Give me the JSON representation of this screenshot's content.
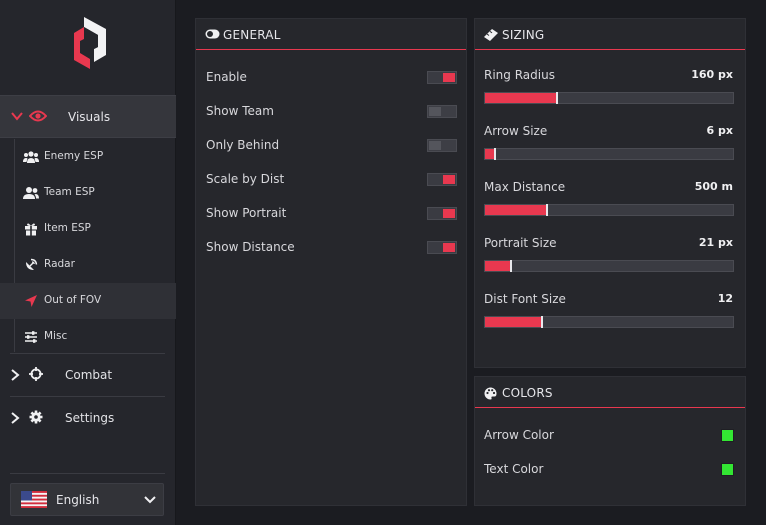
{
  "colors": {
    "accent": "#e8384f",
    "swatch_green": "#33e633"
  },
  "sidebar": {
    "visuals": {
      "label": "Visuals",
      "icon": "eye-icon"
    },
    "sub_items": [
      {
        "label": "Enemy ESP",
        "icon": "users-group-icon",
        "active": false
      },
      {
        "label": "Team ESP",
        "icon": "users-icon",
        "active": false
      },
      {
        "label": "Item ESP",
        "icon": "gift-box-icon",
        "active": false
      },
      {
        "label": "Radar",
        "icon": "satellite-dish-icon",
        "active": false
      },
      {
        "label": "Out of FOV",
        "icon": "location-arrow-icon",
        "active": true
      },
      {
        "label": "Misc",
        "icon": "sliders-icon",
        "active": false
      }
    ],
    "sections": [
      {
        "label": "Combat",
        "icon": "crosshair-icon"
      },
      {
        "label": "Settings",
        "icon": "gear-icon"
      }
    ],
    "language": {
      "label": "English",
      "icon": "us-flag-icon"
    }
  },
  "general": {
    "title": "GENERAL",
    "icon": "toggle-icon",
    "toggles": [
      {
        "label": "Enable",
        "on": true
      },
      {
        "label": "Show Team",
        "on": false
      },
      {
        "label": "Only Behind",
        "on": false
      },
      {
        "label": "Scale by Dist",
        "on": true
      },
      {
        "label": "Show Portrait",
        "on": true
      },
      {
        "label": "Show Distance",
        "on": true
      }
    ]
  },
  "sizing": {
    "title": "SIZING",
    "icon": "ruler-icon",
    "sliders": [
      {
        "label": "Ring Radius",
        "value": "160 px",
        "fraction": 0.29
      },
      {
        "label": "Arrow Size",
        "value": "6 px",
        "fraction": 0.04
      },
      {
        "label": "Max Distance",
        "value": "500 m",
        "fraction": 0.25
      },
      {
        "label": "Portrait Size",
        "value": "21 px",
        "fraction": 0.105
      },
      {
        "label": "Dist Font Size",
        "value": "12",
        "fraction": 0.23
      }
    ]
  },
  "colors_panel": {
    "title": "COLORS",
    "icon": "palette-icon",
    "items": [
      {
        "label": "Arrow Color",
        "color": "#33e633"
      },
      {
        "label": "Text Color",
        "color": "#33e633"
      }
    ]
  }
}
